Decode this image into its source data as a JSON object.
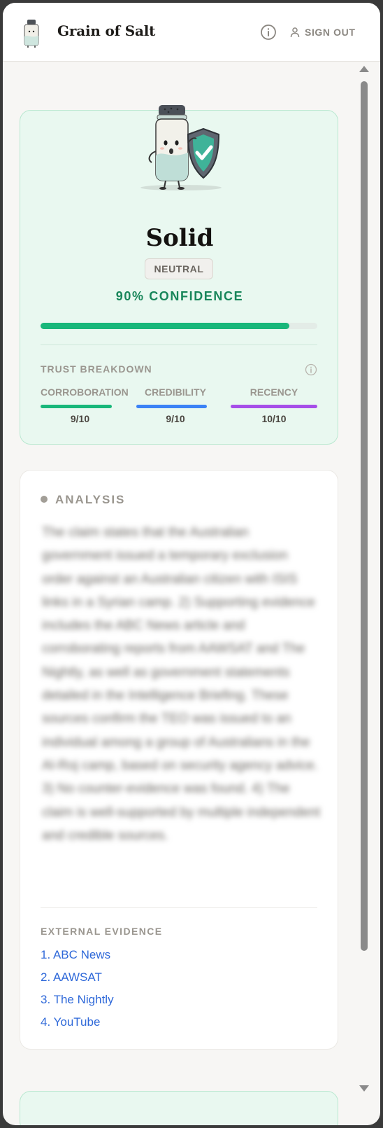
{
  "header": {
    "app_title": "Grain of Salt",
    "info_icon": "info-circle-icon",
    "signout_icon": "user-icon",
    "signout_label": "SIGN OUT"
  },
  "verdict": {
    "title": "Solid",
    "stance": "NEUTRAL",
    "confidence_text": "90% CONFIDENCE",
    "confidence": 0.9,
    "accent_color": "#18b77a",
    "breakdown_label": "TRUST BREAKDOWN",
    "metrics": [
      {
        "label": "CORROBORATION",
        "value": "9/10",
        "score": 0.9,
        "color": "#18b77a"
      },
      {
        "label": "CREDIBILITY",
        "value": "9/10",
        "score": 0.9,
        "color": "#3b82f6"
      },
      {
        "label": "RECENCY",
        "value": "10/10",
        "score": 1.0,
        "color": "#a64ee8"
      }
    ]
  },
  "analysis": {
    "label": "ANALYSIS",
    "text": "The claim states that the Australian government issued a temporary exclusion order against an Australian citizen with ISIS links in a Syrian camp. 2) Supporting evidence includes the ABC News article and corroborating reports from AAWSAT and The Nightly, as well as government statements detailed in the Intelligence Briefing. These sources confirm the TEO was issued to an individual among a group of Australians in the Al-Roj camp, based on security agency advice. 3) No counter-evidence was found. 4) The claim is well-supported by multiple independent and credible sources.",
    "evidence_label": "EXTERNAL EVIDENCE",
    "evidence": [
      "1. ABC News",
      "2. AAWSAT",
      "3. The Nightly",
      "4. YouTube"
    ]
  }
}
